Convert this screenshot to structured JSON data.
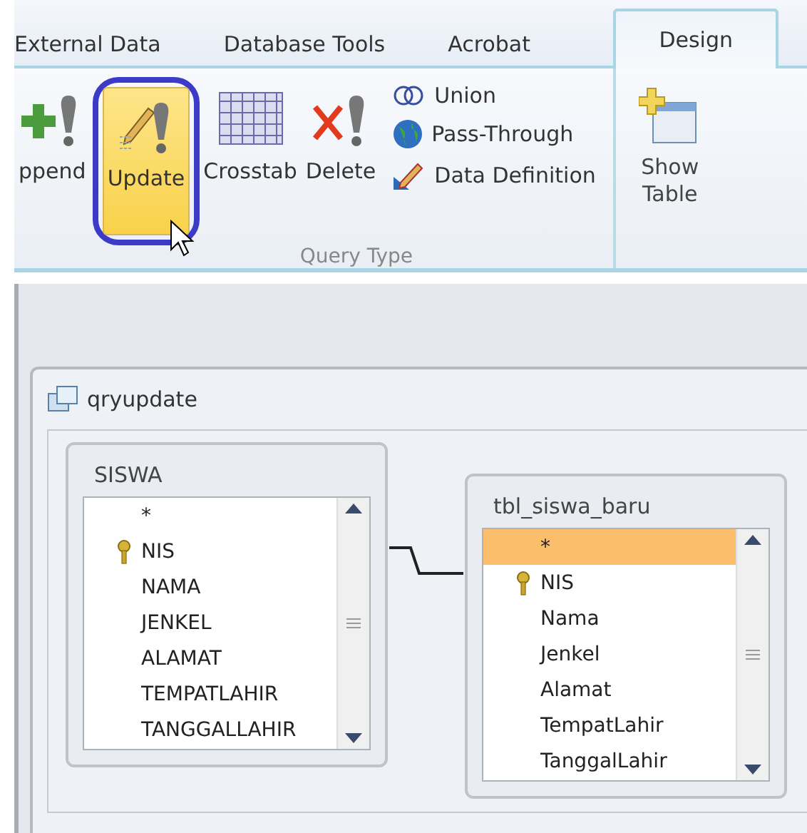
{
  "tabs": [
    {
      "label": "External Data",
      "selected": false
    },
    {
      "label": "Database Tools",
      "selected": false
    },
    {
      "label": "Acrobat",
      "selected": false
    },
    {
      "label": "Design",
      "selected": true
    }
  ],
  "ribbon": {
    "query_type": {
      "label": "Query Type",
      "large_buttons": [
        {
          "kind": "append",
          "label": "ppend",
          "selected": false
        },
        {
          "kind": "update",
          "label": "Update",
          "selected": true
        },
        {
          "kind": "crosstab",
          "label": "Crosstab",
          "selected": false
        },
        {
          "kind": "delete",
          "label": "Delete",
          "selected": false
        }
      ],
      "small_buttons": [
        {
          "kind": "union",
          "label": "Union"
        },
        {
          "kind": "passthrough",
          "label": "Pass-Through"
        },
        {
          "kind": "datadef",
          "label": "Data Definition"
        }
      ]
    },
    "show_table": {
      "label": "Show\nTable"
    }
  },
  "query": {
    "title": "qryupdate",
    "tables": [
      {
        "name": "SISWA",
        "fields": [
          {
            "name": "*",
            "key": false,
            "selected": false
          },
          {
            "name": "NIS",
            "key": true,
            "selected": false
          },
          {
            "name": "NAMA",
            "key": false,
            "selected": false
          },
          {
            "name": "JENKEL",
            "key": false,
            "selected": false
          },
          {
            "name": "ALAMAT",
            "key": false,
            "selected": false
          },
          {
            "name": "TEMPATLAHIR",
            "key": false,
            "selected": false
          },
          {
            "name": "TANGGALLAHIR",
            "key": false,
            "selected": false
          }
        ]
      },
      {
        "name": "tbl_siswa_baru",
        "fields": [
          {
            "name": "*",
            "key": false,
            "selected": true
          },
          {
            "name": "NIS",
            "key": true,
            "selected": false
          },
          {
            "name": "Nama",
            "key": false,
            "selected": false
          },
          {
            "name": "Jenkel",
            "key": false,
            "selected": false
          },
          {
            "name": "Alamat",
            "key": false,
            "selected": false
          },
          {
            "name": "TempatLahir",
            "key": false,
            "selected": false
          },
          {
            "name": "TanggalLahir",
            "key": false,
            "selected": false
          }
        ]
      }
    ]
  }
}
